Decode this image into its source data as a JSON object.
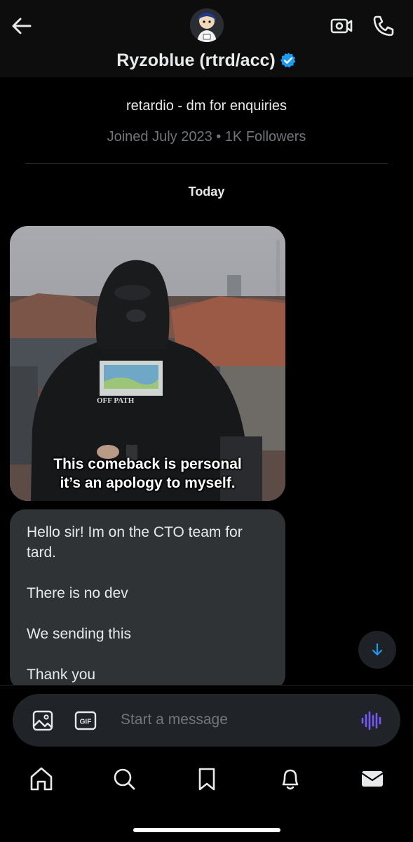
{
  "header": {
    "display_name": "Ryzoblue (rtrd/acc)",
    "back_icon": "arrow-left-icon",
    "video_icon": "video-call-icon",
    "phone_icon": "phone-call-icon",
    "verified_icon": "verified-badge-icon",
    "verified_color": "#1d9bf0"
  },
  "profile": {
    "bio": "retardio - dm for enquiries",
    "meta": "Joined July 2023 • 1K Followers"
  },
  "conversation": {
    "date_separator": "Today",
    "media_caption_line1": "This comeback is personal",
    "media_caption_line2": "it’s an apology to myself.",
    "media_shirt_text": "OFF PATH",
    "message_lines": [
      "Hello sir! Im on the CTO team for",
      "tard.",
      "There is no dev",
      "We sending this",
      "Thank you"
    ]
  },
  "composer": {
    "placeholder": "Start a message",
    "gif_label": "GIF",
    "image_icon": "image-icon",
    "voice_icon": "voice-wave-icon",
    "voice_color": "#7856ff"
  },
  "nav": {
    "items": [
      "home-icon",
      "search-icon",
      "bookmark-icon",
      "notifications-icon",
      "messages-icon"
    ]
  }
}
